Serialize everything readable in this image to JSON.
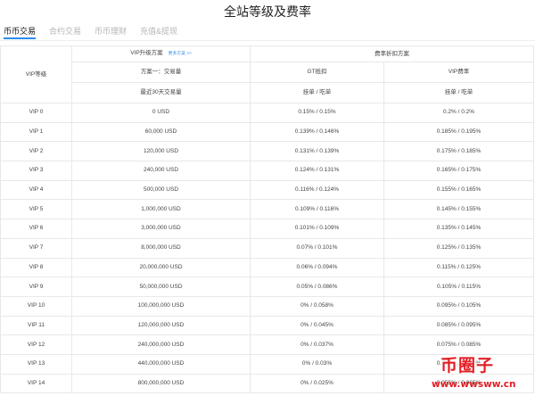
{
  "page_title": "全站等级及费率",
  "tabs": [
    {
      "label": "币币交易",
      "active": true
    },
    {
      "label": "合约交易",
      "active": false
    },
    {
      "label": "币币理财",
      "active": false
    },
    {
      "label": "充值&提现",
      "active": false
    }
  ],
  "table": {
    "header_vip_level": "VIP等级",
    "header_upgrade": "VIP升级方案",
    "header_more_link": "更多方案 >>",
    "header_fee_discount": "费率折扣方案",
    "header_plan_one": "方案一：交易量",
    "header_gt_deduction": "GT抵扣",
    "header_vip_rate": "VIP费率",
    "header_volume_30d": "最近30天交易量",
    "header_maker_taker_gt": "挂单 / 吃单",
    "header_maker_taker_vip": "挂单 / 吃单",
    "rows": [
      {
        "level": "VIP 0",
        "volume": "0 USD",
        "gt": "0.15% / 0.15%",
        "vip": "0.2% / 0.2%"
      },
      {
        "level": "VIP 1",
        "volume": "60,000 USD",
        "gt": "0.139% / 0.146%",
        "vip": "0.185% / 0.195%"
      },
      {
        "level": "VIP 2",
        "volume": "120,000 USD",
        "gt": "0.131% / 0.139%",
        "vip": "0.175% / 0.185%"
      },
      {
        "level": "VIP 3",
        "volume": "240,000 USD",
        "gt": "0.124% / 0.131%",
        "vip": "0.165% / 0.175%"
      },
      {
        "level": "VIP 4",
        "volume": "500,000 USD",
        "gt": "0.116% / 0.124%",
        "vip": "0.155% / 0.165%"
      },
      {
        "level": "VIP 5",
        "volume": "1,000,000 USD",
        "gt": "0.109% / 0.116%",
        "vip": "0.145% / 0.155%"
      },
      {
        "level": "VIP 6",
        "volume": "3,000,000 USD",
        "gt": "0.101% / 0.109%",
        "vip": "0.135% / 0.145%"
      },
      {
        "level": "VIP 7",
        "volume": "8,000,000 USD",
        "gt": "0.07% / 0.101%",
        "vip": "0.125% / 0.135%"
      },
      {
        "level": "VIP 8",
        "volume": "20,000,000 USD",
        "gt": "0.06% / 0.094%",
        "vip": "0.115% / 0.125%"
      },
      {
        "level": "VIP 9",
        "volume": "50,000,000 USD",
        "gt": "0.05% / 0.086%",
        "vip": "0.105% / 0.115%"
      },
      {
        "level": "VIP 10",
        "volume": "100,000,000 USD",
        "gt": "0% / 0.058%",
        "vip": "0.095% / 0.105%"
      },
      {
        "level": "VIP 11",
        "volume": "120,000,000 USD",
        "gt": "0% / 0.045%",
        "vip": "0.085% / 0.095%"
      },
      {
        "level": "VIP 12",
        "volume": "240,000,000 USD",
        "gt": "0% / 0.037%",
        "vip": "0.075% / 0.085%"
      },
      {
        "level": "VIP 13",
        "volume": "440,000,000 USD",
        "gt": "0% / 0.03%",
        "vip": "0.065% / 0.075%"
      },
      {
        "level": "VIP 14",
        "volume": "800,000,000 USD",
        "gt": "0% / 0.025%",
        "vip": "0.055% / 0.065%"
      }
    ]
  },
  "watermark": {
    "logo_text": "币圈子",
    "url_text": "www.wwsww.cn"
  },
  "colors": {
    "accent": "#2d8cf0",
    "border": "#e8e8e8",
    "watermark": "#e21e24"
  }
}
